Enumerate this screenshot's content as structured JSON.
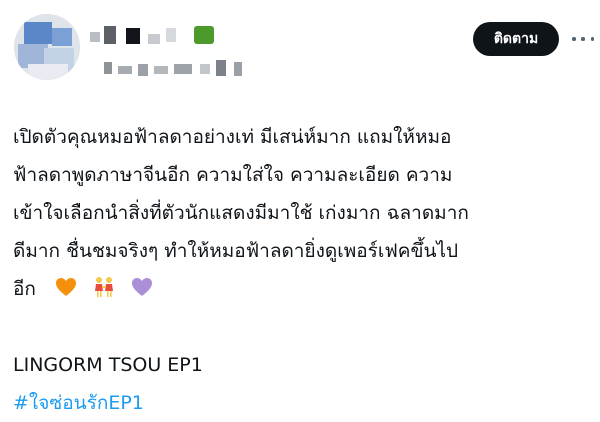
{
  "header": {
    "follow_label": "ติดตาม"
  },
  "tweet": {
    "lines": [
      "เปิดตัวคุณหมอฟ้าลดาอย่างเท่ มีเสน่ห์มาก แถมให้หมอ",
      "ฟ้าลดาพูดภาษาจีนอีก ความใส่ใจ ความละเอียด ความ",
      "เข้าใจเลือกนำสิ่งที่ตัวนักแสดงมีมาใช้ เก่งมาก ฉลาดมาก",
      "ดีมาก ชื่นชมจริงๆ ทำให้หมอฟ้าลดายิ่งดูเพอร์เฟคขึ้นไป",
      "อีก"
    ],
    "emojis": [
      "orange-heart",
      "two-women-holding-hands",
      "purple-heart"
    ],
    "title_line": "LINGORM TSOU EP1",
    "hashtag": "#ใจซ่อนรักEP1"
  },
  "colors": {
    "text": "#0f1419",
    "hashtag": "#1d9bf0",
    "follow_bg": "#0f1419",
    "icon_gray": "#536471"
  }
}
